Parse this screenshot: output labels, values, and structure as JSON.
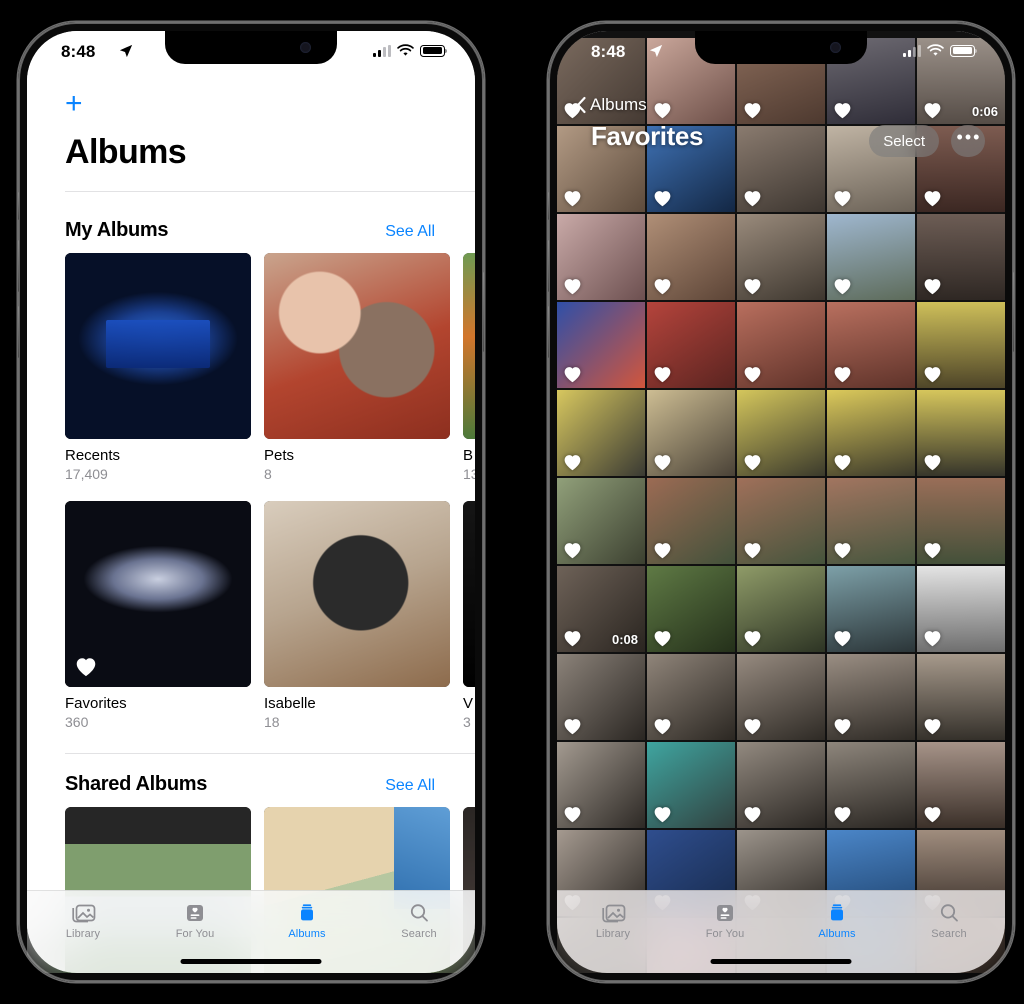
{
  "status_bar": {
    "time": "8:48",
    "location_icon": "location-arrow-icon",
    "cellular_icon": "cellular-bars-icon",
    "wifi_icon": "wifi-icon",
    "battery_icon": "battery-icon"
  },
  "left_phone": {
    "add_button": "+",
    "page_title": "Albums",
    "sections": [
      {
        "heading": "My Albums",
        "see_all": "See All",
        "albums": [
          {
            "name": "Recents",
            "count": "17,409",
            "favorite": false,
            "thumb": "stage-ray-of-light-awards"
          },
          {
            "name": "Pets",
            "count": "8",
            "favorite": false,
            "thumb": "girl-heart-sunglasses-with-dog"
          },
          {
            "name": "B",
            "count": "13",
            "favorite": false,
            "thumb": "baseball-player-field"
          },
          {
            "name": "Favorites",
            "count": "360",
            "favorite": true,
            "thumb": "theater-lightning-thief-stage"
          },
          {
            "name": "Isabelle",
            "count": "18",
            "favorite": false,
            "thumb": "black-cocker-spaniel-puppy"
          },
          {
            "name": "V",
            "count": "3",
            "favorite": false,
            "thumb": "dark-thumbnail"
          }
        ]
      },
      {
        "heading": "Shared Albums",
        "see_all": "See All",
        "albums": [
          {
            "name": "",
            "count": "",
            "favorite": false,
            "thumb": "baseball-team-photo"
          },
          {
            "name": "",
            "count": "",
            "favorite": false,
            "thumb": "house-awning-patio"
          },
          {
            "name": "",
            "count": "",
            "favorite": false,
            "thumb": "indoor-room"
          }
        ]
      }
    ],
    "tab_bar": {
      "active": "Albums",
      "tabs": [
        {
          "label": "Library",
          "icon": "photos-library-icon"
        },
        {
          "label": "For You",
          "icon": "for-you-heart-card-icon"
        },
        {
          "label": "Albums",
          "icon": "albums-stack-icon"
        },
        {
          "label": "Search",
          "icon": "search-magnifier-icon"
        }
      ]
    }
  },
  "right_phone": {
    "back_label": "Albums",
    "back_icon": "chevron-left-icon",
    "title": "Favorites",
    "select_label": "Select",
    "more_label": "•••",
    "grid": {
      "columns": 5,
      "favorite_icon": "heart-filled-icon",
      "cells": [
        {
          "c1": "#7a6a5e",
          "c2": "#453a33",
          "heart": true,
          "duration": ""
        },
        {
          "c1": "#caa79b",
          "c2": "#6d4f48",
          "heart": true,
          "duration": ""
        },
        {
          "c1": "#8a6b5a",
          "c2": "#4d392f",
          "heart": true,
          "duration": ""
        },
        {
          "c1": "#6d6a72",
          "c2": "#2f2d38",
          "heart": true,
          "duration": ""
        },
        {
          "c1": "#9b9189",
          "c2": "#554c46",
          "heart": true,
          "duration": "0:06"
        },
        {
          "c1": "#b29a84",
          "c2": "#5d4b3c",
          "heart": true,
          "duration": ""
        },
        {
          "c1": "#3f72b5",
          "c2": "#132744",
          "heart": true,
          "duration": ""
        },
        {
          "c1": "#8a7b6f",
          "c2": "#3d3630",
          "heart": true,
          "duration": ""
        },
        {
          "c1": "#c0b4a4",
          "c2": "#6b6257",
          "heart": true,
          "duration": ""
        },
        {
          "c1": "#7e5c51",
          "c2": "#3b2722",
          "heart": true,
          "duration": ""
        },
        {
          "c1": "#c9aaa8",
          "c2": "#6d5050",
          "heart": true,
          "duration": ""
        },
        {
          "c1": "#b08f77",
          "c2": "#5c4436",
          "heart": true,
          "duration": ""
        },
        {
          "c1": "#9a8b7c",
          "c2": "#3e372f",
          "heart": true,
          "duration": ""
        },
        {
          "c1": "#9fb7cf",
          "c2": "#5d6b5a",
          "heart": true,
          "duration": ""
        },
        {
          "c1": "#6d5d55",
          "c2": "#2e2723",
          "heart": true,
          "duration": ""
        },
        {
          "c1": "#2f4fa8",
          "c2": "#d2563c",
          "heart": true,
          "duration": ""
        },
        {
          "c1": "#b5443c",
          "c2": "#5a2420",
          "heart": true,
          "duration": ""
        },
        {
          "c1": "#b96f5e",
          "c2": "#5f3229",
          "heart": true,
          "duration": ""
        },
        {
          "c1": "#b9705f",
          "c2": "#5f332a",
          "heart": true,
          "duration": ""
        },
        {
          "c1": "#cfc05a",
          "c2": "#4d4428",
          "heart": true,
          "duration": ""
        },
        {
          "c1": "#d7c75f",
          "c2": "#3a3a33",
          "heart": true,
          "duration": ""
        },
        {
          "c1": "#cdbd93",
          "c2": "#4a4237",
          "heart": true,
          "duration": ""
        },
        {
          "c1": "#d4c65c",
          "c2": "#3b3a2c",
          "heart": true,
          "duration": ""
        },
        {
          "c1": "#dbc95b",
          "c2": "#3c3a2b",
          "heart": true,
          "duration": ""
        },
        {
          "c1": "#d6c65c",
          "c2": "#35342a",
          "heart": true,
          "duration": ""
        },
        {
          "c1": "#91a07a",
          "c2": "#3c4030",
          "heart": true,
          "duration": ""
        },
        {
          "c1": "#9c6b54",
          "c2": "#42513a",
          "heart": true,
          "duration": ""
        },
        {
          "c1": "#a0705a",
          "c2": "#45543c",
          "heart": true,
          "duration": ""
        },
        {
          "c1": "#a27560",
          "c2": "#47563e",
          "heart": true,
          "duration": ""
        },
        {
          "c1": "#9a6e58",
          "c2": "#435039",
          "heart": true,
          "duration": ""
        },
        {
          "c1": "#6e6258",
          "c2": "#2a2520",
          "heart": true,
          "duration": "0:08"
        },
        {
          "c1": "#5f7a45",
          "c2": "#24301a",
          "heart": true,
          "duration": ""
        },
        {
          "c1": "#8f9b68",
          "c2": "#2d3424",
          "heart": true,
          "duration": ""
        },
        {
          "c1": "#7da0a8",
          "c2": "#2b3538",
          "heart": true,
          "duration": ""
        },
        {
          "c1": "#e4e4e4",
          "c2": "#6e6e6e",
          "heart": true,
          "duration": ""
        },
        {
          "c1": "#8c837a",
          "c2": "#2a2622",
          "heart": true,
          "duration": ""
        },
        {
          "c1": "#90857a",
          "c2": "#2b2722",
          "heart": true,
          "duration": ""
        },
        {
          "c1": "#978b80",
          "c2": "#2e2a25",
          "heart": true,
          "duration": ""
        },
        {
          "c1": "#9a8e83",
          "c2": "#2f2b26",
          "heart": true,
          "duration": ""
        },
        {
          "c1": "#a79a8c",
          "c2": "#34302a",
          "heart": true,
          "duration": ""
        },
        {
          "c1": "#a39a90",
          "c2": "#2d2925",
          "heart": true,
          "duration": ""
        },
        {
          "c1": "#3fa5a0",
          "c2": "#31413f",
          "heart": true,
          "duration": ""
        },
        {
          "c1": "#938a80",
          "c2": "#2b2723",
          "heart": true,
          "duration": ""
        },
        {
          "c1": "#8e867c",
          "c2": "#2a2622",
          "heart": true,
          "duration": ""
        },
        {
          "c1": "#a79489",
          "c2": "#3a2f28",
          "heart": true,
          "duration": ""
        },
        {
          "c1": "#a59a90",
          "c2": "#2e2a26",
          "heart": true,
          "duration": ""
        },
        {
          "c1": "#2f4e8e",
          "c2": "#172a4c",
          "heart": true,
          "duration": ""
        },
        {
          "c1": "#9c948b",
          "c2": "#2c2824",
          "heart": true,
          "duration": ""
        },
        {
          "c1": "#4b86c8",
          "c2": "#1f4470",
          "heart": true,
          "duration": ""
        },
        {
          "c1": "#a08d7e",
          "c2": "#3a302a",
          "heart": true,
          "duration": ""
        },
        {
          "c1": "#8e8880",
          "c2": "#2b2824",
          "heart": false,
          "duration": ""
        },
        {
          "c1": "#c39aa0",
          "c2": "#5a3f45",
          "heart": false,
          "duration": ""
        },
        {
          "c1": "#8d8780",
          "c2": "#2b2824",
          "heart": false,
          "duration": ""
        },
        {
          "c1": "#6e88a0",
          "c2": "#2c3a48",
          "heart": false,
          "duration": ""
        },
        {
          "c1": "#8a7468",
          "c2": "#2f2722",
          "heart": false,
          "duration": ""
        }
      ]
    },
    "tab_bar": {
      "active": "Albums",
      "tabs": [
        {
          "label": "Library",
          "icon": "photos-library-icon"
        },
        {
          "label": "For You",
          "icon": "for-you-heart-card-icon"
        },
        {
          "label": "Albums",
          "icon": "albums-stack-icon"
        },
        {
          "label": "Search",
          "icon": "search-magnifier-icon"
        }
      ]
    }
  },
  "colors": {
    "accent": "#0a84ff",
    "inactive": "#8e8e93",
    "background": "#000000"
  }
}
